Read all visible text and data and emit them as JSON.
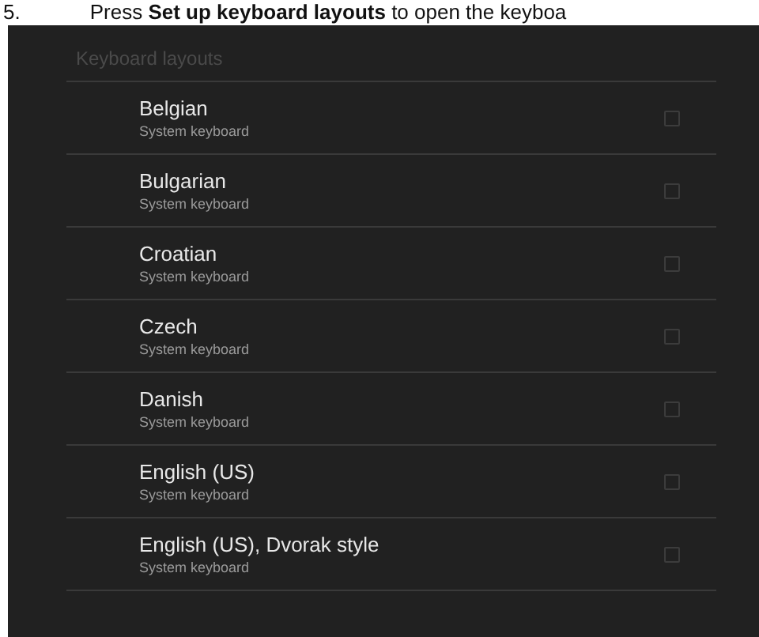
{
  "instruction": {
    "number": "5.",
    "text": "Press **Set up keyboard layouts** to open the keyboa"
  },
  "screen": {
    "title": "Keyboard layouts",
    "layouts": [
      {
        "name": "Belgian",
        "summary": "System keyboard",
        "checked": false
      },
      {
        "name": "Bulgarian",
        "summary": "System keyboard",
        "checked": false
      },
      {
        "name": "Croatian",
        "summary": "System keyboard",
        "checked": false
      },
      {
        "name": "Czech",
        "summary": "System keyboard",
        "checked": false
      },
      {
        "name": "Danish",
        "summary": "System keyboard",
        "checked": false
      },
      {
        "name": "English (US)",
        "summary": "System keyboard",
        "checked": false
      },
      {
        "name": "English (US), Dvorak style",
        "summary": "System keyboard",
        "checked": false
      }
    ]
  }
}
